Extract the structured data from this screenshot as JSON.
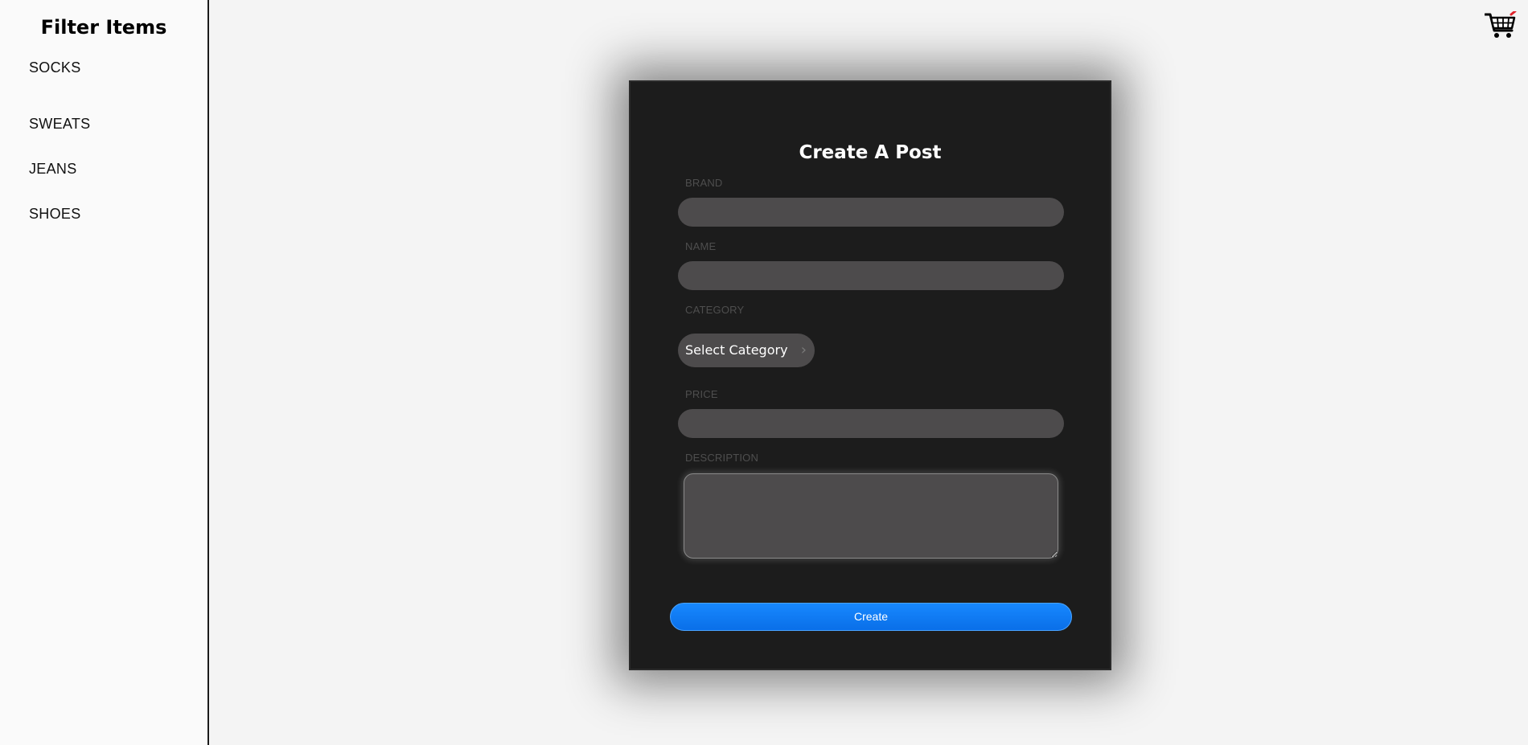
{
  "sidebar": {
    "title": "Filter Items",
    "items": [
      {
        "label": "SOCKS"
      },
      {
        "label": "SWEATS"
      },
      {
        "label": "JEANS"
      },
      {
        "label": "SHOES"
      }
    ]
  },
  "header": {
    "cart_icon": "cart-icon"
  },
  "form": {
    "title": "Create A Post",
    "brand_label": "BRAND",
    "brand_value": "",
    "name_label": "NAME",
    "name_value": "",
    "category_label": "CATEGORY",
    "category_select": "Select Category",
    "price_label": "PRICE",
    "price_value": "",
    "description_label": "DESCRIPTION",
    "description_value": "",
    "submit_label": "Create"
  },
  "colors": {
    "accent": "#0a74ff",
    "card_bg": "#1c1c1c",
    "input_bg": "#4d4b4c"
  }
}
